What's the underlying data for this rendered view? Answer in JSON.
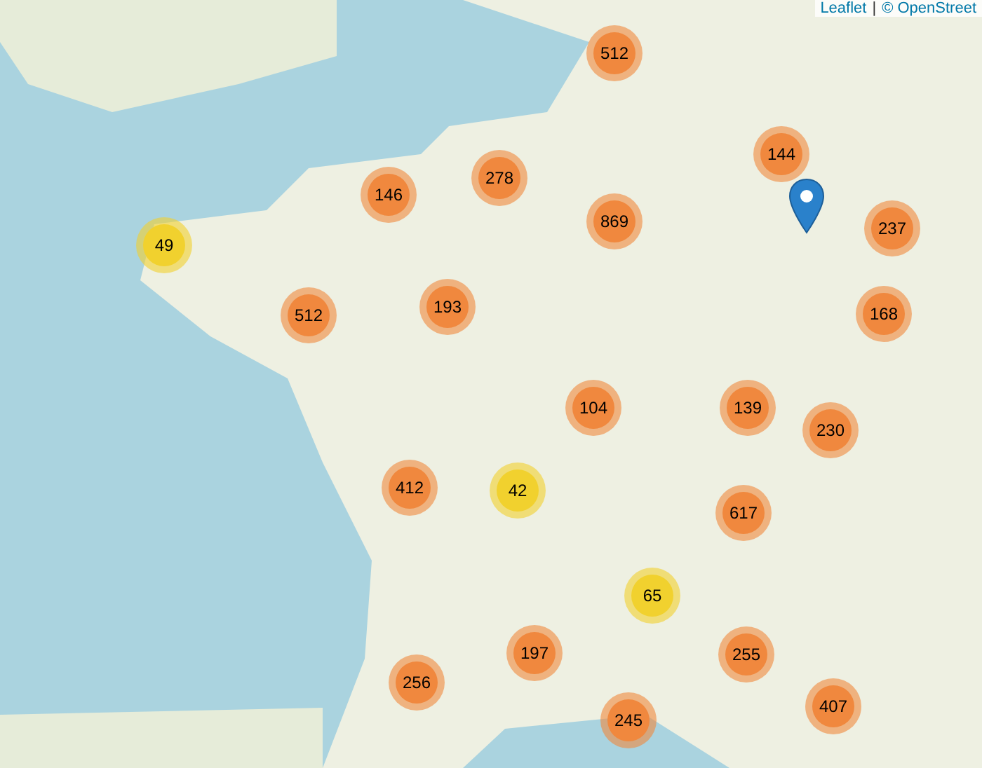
{
  "clusters": [
    {
      "count": "512",
      "color": "#f0883e"
    },
    {
      "count": "144",
      "color": "#f0883e"
    },
    {
      "count": "237",
      "color": "#f0883e"
    },
    {
      "count": "168",
      "color": "#f0883e"
    },
    {
      "count": "230",
      "color": "#f0883e"
    },
    {
      "count": "139",
      "color": "#f0883e"
    },
    {
      "count": "104",
      "color": "#f0883e"
    },
    {
      "count": "869",
      "color": "#f0883e"
    },
    {
      "count": "278",
      "color": "#f0883e"
    },
    {
      "count": "146",
      "color": "#f0883e"
    },
    {
      "count": "49",
      "color": "#f1d12e"
    },
    {
      "count": "512",
      "color": "#f0883e"
    },
    {
      "count": "193",
      "color": "#f0883e"
    },
    {
      "count": "412",
      "color": "#f0883e"
    },
    {
      "count": "42",
      "color": "#f1d12e"
    },
    {
      "count": "617",
      "color": "#f0883e"
    },
    {
      "count": "65",
      "color": "#f1d12e"
    },
    {
      "count": "255",
      "color": "#f0883e"
    },
    {
      "count": "197",
      "color": "#f0883e"
    },
    {
      "count": "256",
      "color": "#f0883e"
    },
    {
      "count": "245",
      "color": "#f0883e"
    },
    {
      "count": "407",
      "color": "#f0883e"
    }
  ],
  "attribution": {
    "link": "Leaflet",
    "separator": "|",
    "text": "© OpenStreet"
  }
}
